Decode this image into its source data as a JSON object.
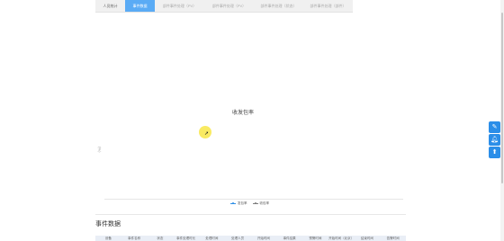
{
  "tabs": [
    {
      "label": "人员统计"
    },
    {
      "label": "事件数据"
    },
    {
      "label": "部件事件处理（PV）"
    },
    {
      "label": "部件事件处理（PV）"
    },
    {
      "label": "部件事件处理（状态）"
    },
    {
      "label": "部件事件处理（部件）"
    }
  ],
  "chart": {
    "title": "收发包率",
    "ylabel": "（%）",
    "legend": [
      {
        "name": "发包率",
        "color": "#2f8fe6"
      },
      {
        "name": "收包率",
        "color": "#7c7c7c"
      }
    ]
  },
  "chart_data": {
    "type": "line",
    "title": "收发包率",
    "ylabel": "（%）",
    "series": [
      {
        "name": "发包率",
        "values": []
      },
      {
        "name": "收包率",
        "values": []
      }
    ],
    "legend_position": "bottom"
  },
  "section": {
    "title": "事件数据"
  },
  "table": {
    "headers": [
      "设备",
      "事件名称",
      "状态",
      "事件处理时长",
      "处理时间",
      "处理人员",
      "开始时间",
      "事件结果",
      "预警时间",
      "开始时间（北京）",
      "结束时间",
      "告警时间"
    ]
  },
  "fabs": {
    "edit": "edit-icon",
    "bell": "bell-icon",
    "top": "arrow-up-icon"
  },
  "colors": {
    "active_tab": "#5aabf5",
    "fab": "#2b8ee8"
  }
}
